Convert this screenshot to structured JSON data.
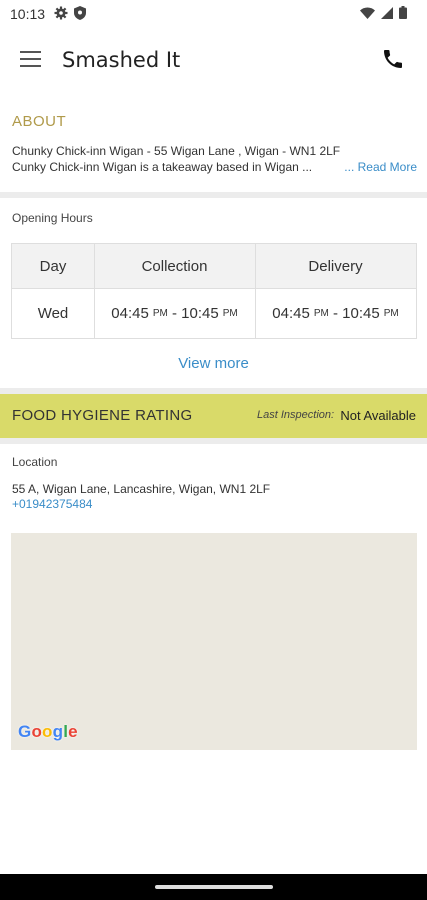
{
  "status_bar": {
    "time": "10:13",
    "icons": [
      "gear-icon",
      "shield-icon",
      "wifi-icon",
      "signal-icon",
      "battery-icon"
    ]
  },
  "app_bar": {
    "title": "Smashed It",
    "icons": [
      "menu-icon",
      "phone-icon"
    ]
  },
  "about": {
    "heading": "ABOUT",
    "line1": "Chunky Chick-inn Wigan - 55  Wigan Lane , Wigan  -  WN1 2LF",
    "line2": "Cunky Chick-inn Wigan is a takeaway based in Wigan ...",
    "read_more": "... Read More"
  },
  "opening_hours": {
    "label": "Opening Hours",
    "columns": [
      "Day",
      "Collection",
      "Delivery"
    ],
    "rows": [
      {
        "day": "Wed",
        "collection": {
          "start_time": "04:45",
          "start_period": "PM",
          "sep": " - ",
          "end_time": "10:45",
          "end_period": "PM"
        },
        "delivery": {
          "start_time": "04:45",
          "start_period": "PM",
          "sep": " - ",
          "end_time": "10:45",
          "end_period": "PM"
        }
      }
    ],
    "view_more": "View more"
  },
  "hygiene": {
    "title": "FOOD HYGIENE RATING",
    "last_inspection_label": "Last Inspection:",
    "last_inspection_value": "Not Available"
  },
  "location": {
    "label": "Location",
    "address": "55 A, Wigan Lane, Lancashire, Wigan, WN1 2LF",
    "phone": "+01942375484"
  },
  "map": {
    "logo_letters": [
      "G",
      "o",
      "o",
      "g",
      "l",
      "e"
    ],
    "logo_colors": [
      "#4285F4",
      "#EA4335",
      "#FBBC05",
      "#4285F4",
      "#34A853",
      "#EA4335"
    ]
  },
  "colors": {
    "accent_gold": "#b09a4a",
    "link_blue": "#3a8dc8",
    "hygiene_yellow": "#d9da69"
  }
}
